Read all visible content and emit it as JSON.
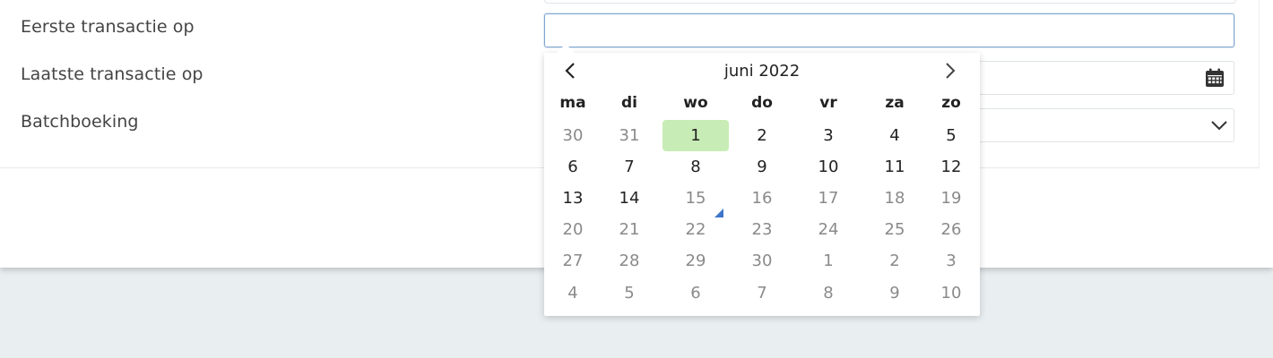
{
  "form": {
    "first_transaction_label": "Eerste transactie op",
    "last_transaction_label": "Laatste transactie op",
    "batch_label": "Batchboeking",
    "first_transaction_value": "",
    "last_transaction_value": "",
    "batch_value": ""
  },
  "datepicker": {
    "month_label": "juni 2022",
    "weekdays": [
      "ma",
      "di",
      "wo",
      "do",
      "vr",
      "za",
      "zo"
    ],
    "weeks": [
      [
        {
          "d": "30",
          "muted": true
        },
        {
          "d": "31",
          "muted": true
        },
        {
          "d": "1",
          "muted": false,
          "selected": true
        },
        {
          "d": "2",
          "muted": false
        },
        {
          "d": "3",
          "muted": false
        },
        {
          "d": "4",
          "muted": false
        },
        {
          "d": "5",
          "muted": false
        }
      ],
      [
        {
          "d": "6",
          "muted": false
        },
        {
          "d": "7",
          "muted": false
        },
        {
          "d": "8",
          "muted": false
        },
        {
          "d": "9",
          "muted": false
        },
        {
          "d": "10",
          "muted": false
        },
        {
          "d": "11",
          "muted": false
        },
        {
          "d": "12",
          "muted": false
        }
      ],
      [
        {
          "d": "13",
          "muted": false
        },
        {
          "d": "14",
          "muted": false
        },
        {
          "d": "15",
          "muted": true,
          "today": true
        },
        {
          "d": "16",
          "muted": true
        },
        {
          "d": "17",
          "muted": true
        },
        {
          "d": "18",
          "muted": true
        },
        {
          "d": "19",
          "muted": true
        }
      ],
      [
        {
          "d": "20",
          "muted": true
        },
        {
          "d": "21",
          "muted": true
        },
        {
          "d": "22",
          "muted": true
        },
        {
          "d": "23",
          "muted": true
        },
        {
          "d": "24",
          "muted": true
        },
        {
          "d": "25",
          "muted": true
        },
        {
          "d": "26",
          "muted": true
        }
      ],
      [
        {
          "d": "27",
          "muted": true
        },
        {
          "d": "28",
          "muted": true
        },
        {
          "d": "29",
          "muted": true
        },
        {
          "d": "30",
          "muted": true
        },
        {
          "d": "1",
          "muted": true
        },
        {
          "d": "2",
          "muted": true
        },
        {
          "d": "3",
          "muted": true
        }
      ],
      [
        {
          "d": "4",
          "muted": true
        },
        {
          "d": "5",
          "muted": true
        },
        {
          "d": "6",
          "muted": true
        },
        {
          "d": "7",
          "muted": true
        },
        {
          "d": "8",
          "muted": true
        },
        {
          "d": "9",
          "muted": true
        },
        {
          "d": "10",
          "muted": true
        }
      ]
    ],
    "icons": {
      "prev": "chevron-left-icon",
      "next": "chevron-right-icon"
    },
    "colors": {
      "selected_bg": "#c8ecb5",
      "today_marker": "#3f76c9"
    }
  },
  "icons": {
    "calendar": "calendar-icon",
    "dropdown": "chevron-down-icon"
  }
}
